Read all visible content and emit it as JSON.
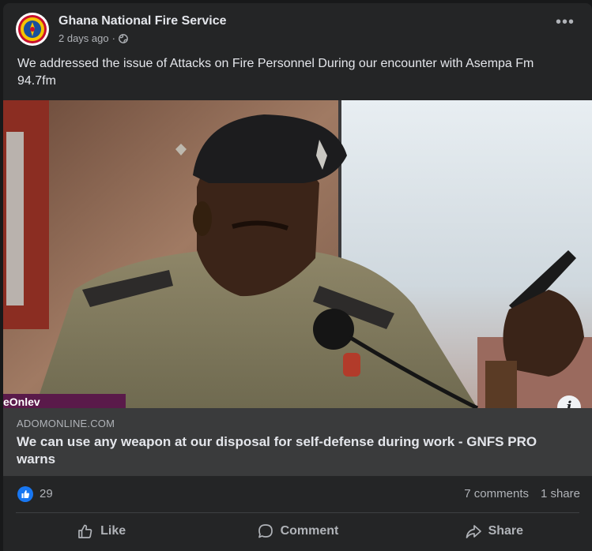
{
  "post": {
    "page_name": "Ghana National Fire Service",
    "time": "2 days ago",
    "separator": "·",
    "text": "We addressed the issue of Attacks on Fire Personnel During our encounter with Asempa Fm 94.7fm",
    "more_icon": "more-options-icon",
    "privacy_icon": "globe-icon"
  },
  "photo": {
    "overlay_text": "eOnlev"
  },
  "link": {
    "domain": "ADOMONLINE.COM",
    "title": "We can use any weapon at our disposal for self-defense during work - GNFS PRO warns",
    "info_label": "i"
  },
  "stats": {
    "likes": "29",
    "comments": "7 comments",
    "shares": "1 share"
  },
  "actions": {
    "like": "Like",
    "comment": "Comment",
    "share": "Share"
  },
  "colors": {
    "background": "#18191a",
    "card": "#242526",
    "link_box": "#3a3b3c",
    "like_blue": "#1877f2",
    "secondary_text": "#b0b3b8"
  }
}
